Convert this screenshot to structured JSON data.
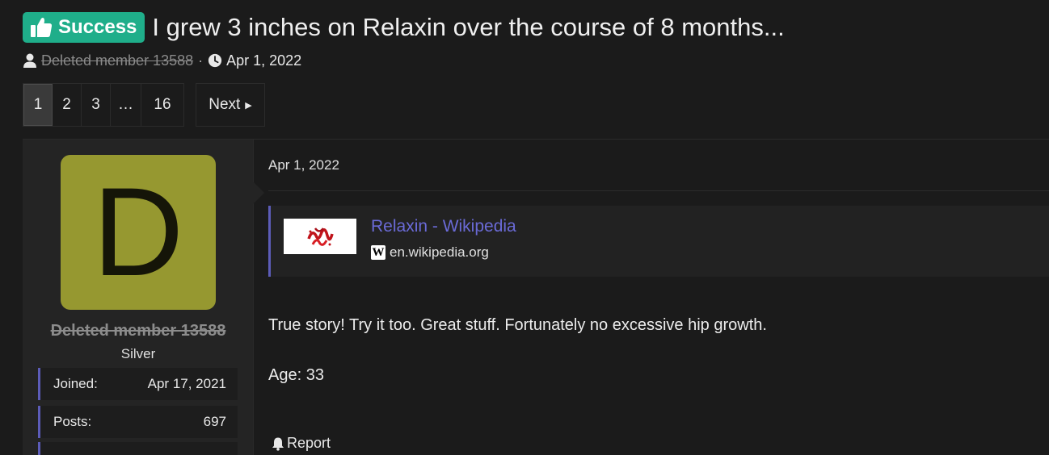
{
  "thread": {
    "prefix": "Success",
    "title": "I grew 3 inches on Relaxin over the course of 8 months...",
    "author": "Deleted member 13588",
    "separator": "·",
    "date": "Apr 1, 2022"
  },
  "pagination": {
    "pages": [
      "1",
      "2",
      "3",
      "…",
      "16"
    ],
    "current": "1",
    "next_label": "Next"
  },
  "user": {
    "avatar_letter": "D",
    "avatar_color": "#969830",
    "name": "Deleted member 13588",
    "title": "Silver",
    "stats": [
      {
        "label": "Joined:",
        "value": "Apr 17, 2021"
      },
      {
        "label": "Posts:",
        "value": "697"
      }
    ]
  },
  "post": {
    "date": "Apr 1, 2022",
    "unfurl": {
      "title": "Relaxin - Wikipedia",
      "domain": "en.wikipedia.org",
      "icon": "wikipedia-icon"
    },
    "body_line_1": "True story! Try it too. Great stuff. Fortunately no excessive hip growth.",
    "body_line_2": "Age: 33",
    "report_label": "Report"
  },
  "colors": {
    "prefix_bg": "#1fae8a",
    "link": "#6a6ad6",
    "accent_border": "#5c5cb8"
  }
}
